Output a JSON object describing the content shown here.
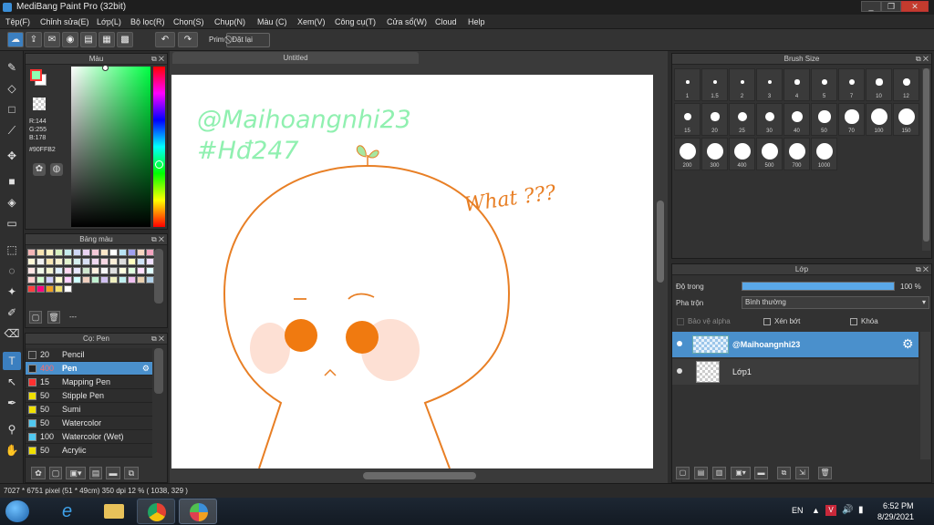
{
  "window": {
    "title": "MediBang Paint Pro (32bit)",
    "minimize": "_",
    "maximize": "❐",
    "close": "✕"
  },
  "menu": [
    {
      "label": "Tệp(F)"
    },
    {
      "label": "Chỉnh sửa(E)"
    },
    {
      "label": "Lớp(L)"
    },
    {
      "label": "Bộ lọc(R)"
    },
    {
      "label": "Chọn(S)"
    },
    {
      "label": "Chụp(N)"
    },
    {
      "label": "Màu (C)"
    },
    {
      "label": "Xem(V)"
    },
    {
      "label": "Công cụ(T)"
    },
    {
      "label": "Cửa sổ(W)"
    },
    {
      "label": "Cloud"
    },
    {
      "label": "Help"
    }
  ],
  "toolbar": {
    "prim_label": "Prim",
    "reset_label": "Đặt lại"
  },
  "color_panel": {
    "title": "Màu",
    "r": "R:144",
    "g": "G:255",
    "b": "B:178",
    "hex": "#90FFB2",
    "fg_color": "#90FFB2",
    "bg_color": "#FFFFFF"
  },
  "palette_panel": {
    "title": "Bảng màu",
    "dashes": "---",
    "colors": [
      "#f4b6b6",
      "#f7e3b0",
      "#fbf2c4",
      "#d7f0c0",
      "#c6ecec",
      "#cfd8f7",
      "#ead3f2",
      "#f4c9d8",
      "#fde7c8",
      "#ffffff",
      "#b8e3f4",
      "#a0a0f0",
      "#f7d7c2",
      "#f4a5c0",
      "#fff8d8",
      "#f0f0f0",
      "#f8e7b5",
      "#f7f1d0",
      "#e4f4cf",
      "#d6f1f0",
      "#d8e0f5",
      "#f0d8f0",
      "#f8d8e4",
      "#fcefd8",
      "#dcdcdc",
      "#ffffc0",
      "#cfe3f7",
      "#f0e0ff",
      "#ffe6e6",
      "#f0f8e8",
      "#f4f4d0",
      "#e0f0ff",
      "#ffd8f0",
      "#e8e8ff",
      "#d0e8d0",
      "#fff0e0",
      "#f8f8f8",
      "#e0e0e0",
      "#ffffe0",
      "#e0ffe0",
      "#ffe0ff",
      "#e0ffff",
      "#ffd0d0",
      "#d0ffd0",
      "#d0d0ff",
      "#ffffd0",
      "#ffd0ff",
      "#d0ffff",
      "#f0d0c0",
      "#c0f0d0",
      "#d0c0f0",
      "#f0f0c0",
      "#c0f0f0",
      "#f0c0f0",
      "#e8d0b0",
      "#b0d0e8",
      "#ff4040",
      "#ff0080",
      "#f0a020",
      "#f0e070",
      "#ffffff"
    ]
  },
  "brush_panel": {
    "title": "Cọ: Pen",
    "items": [
      {
        "size": "20",
        "name": "Pencil",
        "color": "#333333"
      },
      {
        "size": "400",
        "name": "Pen",
        "color": "#222222"
      },
      {
        "size": "15",
        "name": "Mapping Pen",
        "color": "#ff3030"
      },
      {
        "size": "50",
        "name": "Stipple Pen",
        "color": "#f0e000"
      },
      {
        "size": "50",
        "name": "Sumi",
        "color": "#f0e000"
      },
      {
        "size": "50",
        "name": "Watercolor",
        "color": "#50c8f0"
      },
      {
        "size": "100",
        "name": "Watercolor (Wet)",
        "color": "#50c8f0"
      },
      {
        "size": "50",
        "name": "Acrylic",
        "color": "#f0e000"
      }
    ]
  },
  "document": {
    "tab": "Untitled",
    "watermark_line1": "@Maihoangnhi23",
    "watermark_line2": "#Hđ247",
    "speech": "What ???",
    "text_color": "#90f0b0"
  },
  "brush_size_panel": {
    "title": "Brush Size",
    "sizes": [
      "1",
      "1.5",
      "2",
      "3",
      "4",
      "5",
      "7",
      "10",
      "12",
      "15",
      "20",
      "25",
      "30",
      "40",
      "50",
      "70",
      "100",
      "150",
      "200",
      "300",
      "400",
      "500",
      "700",
      "1000"
    ]
  },
  "layer_panel": {
    "title": "Lớp",
    "opacity_label": "Độ trong",
    "opacity_value": "100 %",
    "opacity": 1.0,
    "blend_label": "Pha trộn",
    "blend_value": "Bình thường",
    "protect_alpha": "Bảo vệ alpha",
    "clip": "Xén bớt",
    "lock": "Khóa",
    "layers": [
      {
        "name": "@Maihoangnhi23",
        "selected": true
      },
      {
        "name": "Lớp1",
        "selected": false
      }
    ]
  },
  "status": {
    "text": "7027 * 6751 pixel   (51 * 49cm)   350 dpi   12 %   ( 1038, 329 )"
  },
  "taskbar": {
    "lang": "EN",
    "time": "6:52 PM",
    "date": "8/29/2021"
  }
}
